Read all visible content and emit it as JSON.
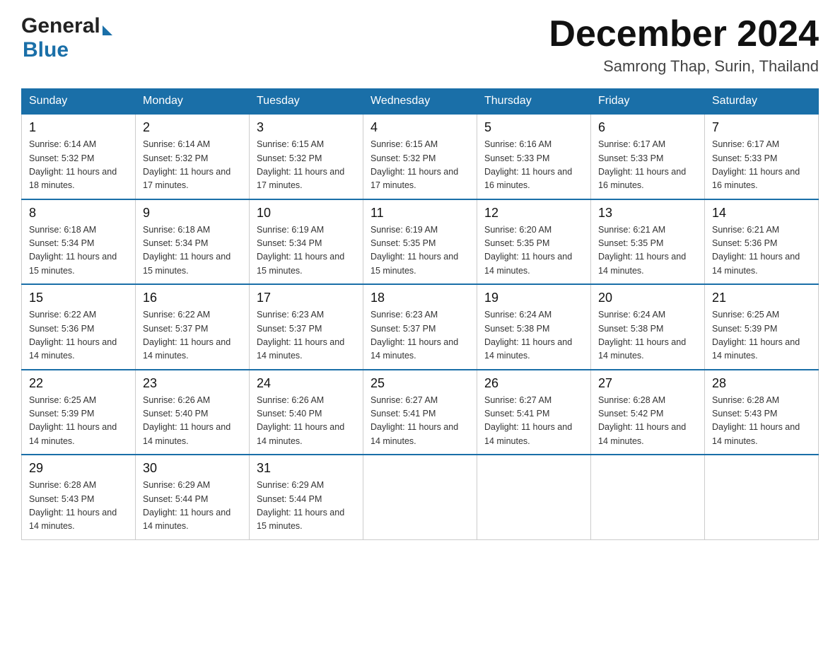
{
  "header": {
    "logo": {
      "text_general": "General",
      "flag_color": "#1a6fa8",
      "text_blue": "Blue"
    },
    "title": "December 2024",
    "location": "Samrong Thap, Surin, Thailand"
  },
  "calendar": {
    "days_of_week": [
      "Sunday",
      "Monday",
      "Tuesday",
      "Wednesday",
      "Thursday",
      "Friday",
      "Saturday"
    ],
    "weeks": [
      [
        {
          "day": "1",
          "sunrise": "6:14 AM",
          "sunset": "5:32 PM",
          "daylight": "11 hours and 18 minutes."
        },
        {
          "day": "2",
          "sunrise": "6:14 AM",
          "sunset": "5:32 PM",
          "daylight": "11 hours and 17 minutes."
        },
        {
          "day": "3",
          "sunrise": "6:15 AM",
          "sunset": "5:32 PM",
          "daylight": "11 hours and 17 minutes."
        },
        {
          "day": "4",
          "sunrise": "6:15 AM",
          "sunset": "5:32 PM",
          "daylight": "11 hours and 17 minutes."
        },
        {
          "day": "5",
          "sunrise": "6:16 AM",
          "sunset": "5:33 PM",
          "daylight": "11 hours and 16 minutes."
        },
        {
          "day": "6",
          "sunrise": "6:17 AM",
          "sunset": "5:33 PM",
          "daylight": "11 hours and 16 minutes."
        },
        {
          "day": "7",
          "sunrise": "6:17 AM",
          "sunset": "5:33 PM",
          "daylight": "11 hours and 16 minutes."
        }
      ],
      [
        {
          "day": "8",
          "sunrise": "6:18 AM",
          "sunset": "5:34 PM",
          "daylight": "11 hours and 15 minutes."
        },
        {
          "day": "9",
          "sunrise": "6:18 AM",
          "sunset": "5:34 PM",
          "daylight": "11 hours and 15 minutes."
        },
        {
          "day": "10",
          "sunrise": "6:19 AM",
          "sunset": "5:34 PM",
          "daylight": "11 hours and 15 minutes."
        },
        {
          "day": "11",
          "sunrise": "6:19 AM",
          "sunset": "5:35 PM",
          "daylight": "11 hours and 15 minutes."
        },
        {
          "day": "12",
          "sunrise": "6:20 AM",
          "sunset": "5:35 PM",
          "daylight": "11 hours and 14 minutes."
        },
        {
          "day": "13",
          "sunrise": "6:21 AM",
          "sunset": "5:35 PM",
          "daylight": "11 hours and 14 minutes."
        },
        {
          "day": "14",
          "sunrise": "6:21 AM",
          "sunset": "5:36 PM",
          "daylight": "11 hours and 14 minutes."
        }
      ],
      [
        {
          "day": "15",
          "sunrise": "6:22 AM",
          "sunset": "5:36 PM",
          "daylight": "11 hours and 14 minutes."
        },
        {
          "day": "16",
          "sunrise": "6:22 AM",
          "sunset": "5:37 PM",
          "daylight": "11 hours and 14 minutes."
        },
        {
          "day": "17",
          "sunrise": "6:23 AM",
          "sunset": "5:37 PM",
          "daylight": "11 hours and 14 minutes."
        },
        {
          "day": "18",
          "sunrise": "6:23 AM",
          "sunset": "5:37 PM",
          "daylight": "11 hours and 14 minutes."
        },
        {
          "day": "19",
          "sunrise": "6:24 AM",
          "sunset": "5:38 PM",
          "daylight": "11 hours and 14 minutes."
        },
        {
          "day": "20",
          "sunrise": "6:24 AM",
          "sunset": "5:38 PM",
          "daylight": "11 hours and 14 minutes."
        },
        {
          "day": "21",
          "sunrise": "6:25 AM",
          "sunset": "5:39 PM",
          "daylight": "11 hours and 14 minutes."
        }
      ],
      [
        {
          "day": "22",
          "sunrise": "6:25 AM",
          "sunset": "5:39 PM",
          "daylight": "11 hours and 14 minutes."
        },
        {
          "day": "23",
          "sunrise": "6:26 AM",
          "sunset": "5:40 PM",
          "daylight": "11 hours and 14 minutes."
        },
        {
          "day": "24",
          "sunrise": "6:26 AM",
          "sunset": "5:40 PM",
          "daylight": "11 hours and 14 minutes."
        },
        {
          "day": "25",
          "sunrise": "6:27 AM",
          "sunset": "5:41 PM",
          "daylight": "11 hours and 14 minutes."
        },
        {
          "day": "26",
          "sunrise": "6:27 AM",
          "sunset": "5:41 PM",
          "daylight": "11 hours and 14 minutes."
        },
        {
          "day": "27",
          "sunrise": "6:28 AM",
          "sunset": "5:42 PM",
          "daylight": "11 hours and 14 minutes."
        },
        {
          "day": "28",
          "sunrise": "6:28 AM",
          "sunset": "5:43 PM",
          "daylight": "11 hours and 14 minutes."
        }
      ],
      [
        {
          "day": "29",
          "sunrise": "6:28 AM",
          "sunset": "5:43 PM",
          "daylight": "11 hours and 14 minutes."
        },
        {
          "day": "30",
          "sunrise": "6:29 AM",
          "sunset": "5:44 PM",
          "daylight": "11 hours and 14 minutes."
        },
        {
          "day": "31",
          "sunrise": "6:29 AM",
          "sunset": "5:44 PM",
          "daylight": "11 hours and 15 minutes."
        },
        null,
        null,
        null,
        null
      ]
    ]
  }
}
